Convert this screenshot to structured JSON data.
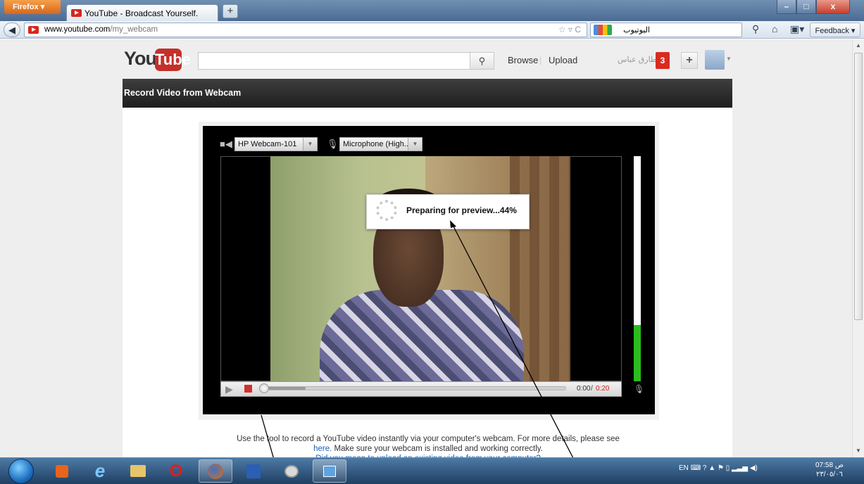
{
  "browser": {
    "menu_button": "Firefox",
    "tab_title": "YouTube - Broadcast Yourself.",
    "new_tab": "+",
    "url_host": "www.youtube.com",
    "url_path": "/my_webcam",
    "search_text": "اليوتيوب",
    "feedback": "Feedback"
  },
  "header": {
    "logo_you": "You",
    "logo_tube": "Tube",
    "search_placeholder": "",
    "browse": "Browse",
    "upload": "Upload",
    "username": "طارق عباس",
    "notification_count": "3",
    "add": "+"
  },
  "recorder": {
    "title": "Record Video from Webcam",
    "camera": "HP Webcam-101",
    "microphone": "Microphone (High..",
    "status": "Preparing for preview...44%",
    "preview_progress": 0.44,
    "mic_level": 0.25,
    "time_current": "0:00",
    "time_separator": "/",
    "time_total": "0:20"
  },
  "help": {
    "line1": "Use the tool to record a YouTube video instantly via your computer's webcam. For more details, please see",
    "link_here": "here.",
    "line2": "Make sure your webcam is installed and working correctly.",
    "line3": "Did you mean to upload an existing video from your computer?"
  },
  "taskbar": {
    "lang": "EN",
    "time": "07:58 ص",
    "date": "٢٣/٠٥/٠٦"
  },
  "colors": {
    "youtube_red": "#c4302b",
    "meter_green": "#2bbd1e",
    "time_total_red": "#cc1f1f",
    "link_blue": "#1c62b9"
  }
}
